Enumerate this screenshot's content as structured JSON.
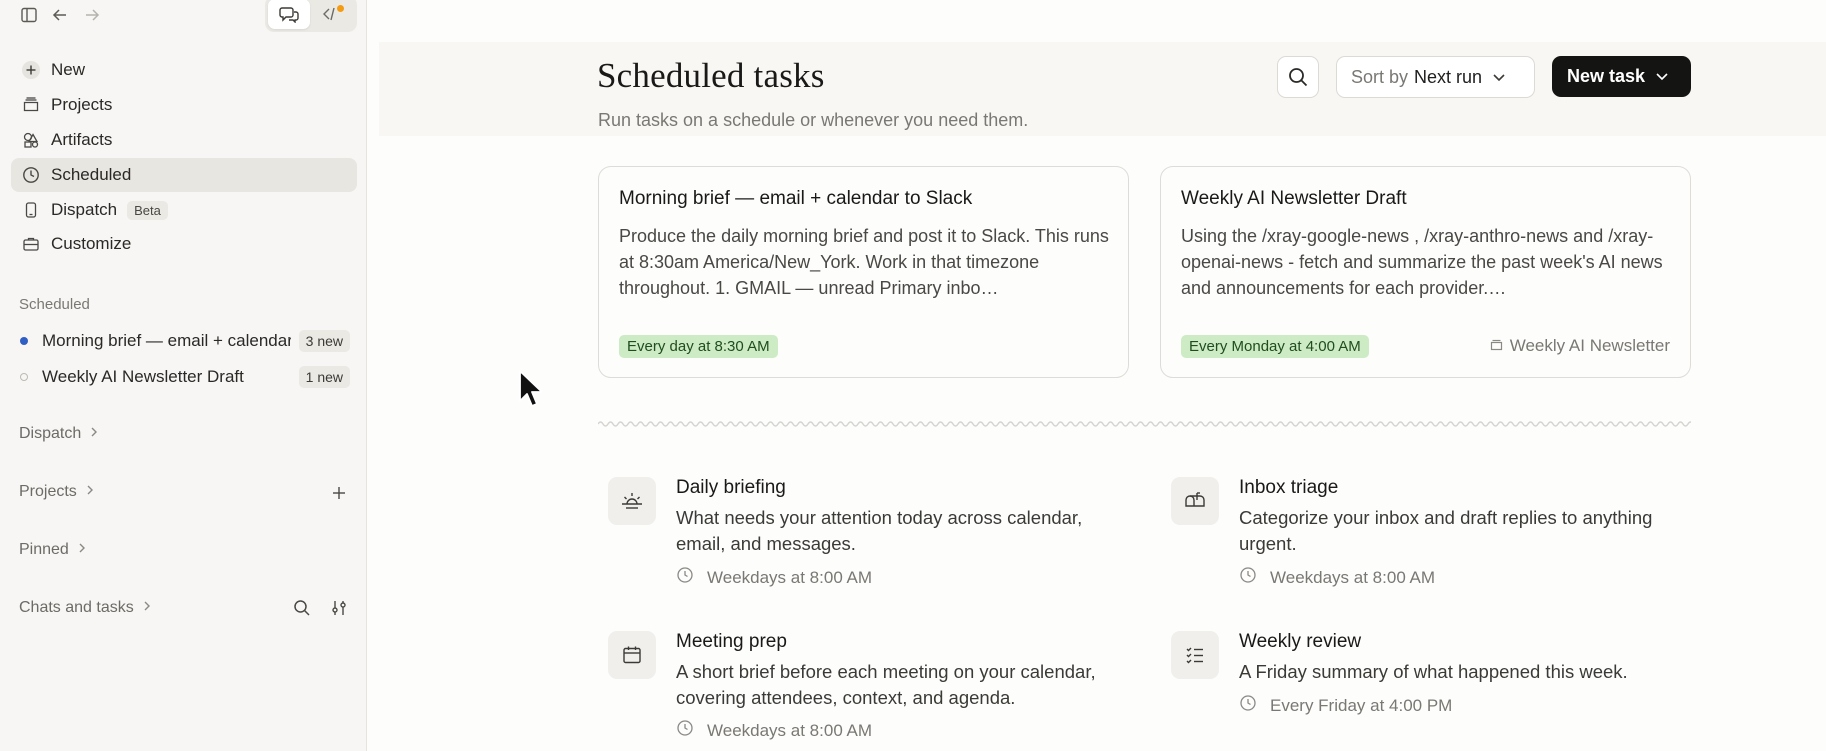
{
  "sidebar": {
    "nav": [
      {
        "label": "New",
        "icon": "plus-icon"
      },
      {
        "label": "Projects",
        "icon": "folder-icon"
      },
      {
        "label": "Artifacts",
        "icon": "shapes-icon"
      },
      {
        "label": "Scheduled",
        "icon": "clock-icon"
      },
      {
        "label": "Dispatch",
        "icon": "phone-icon",
        "badge": "Beta"
      },
      {
        "label": "Customize",
        "icon": "briefcase-icon"
      }
    ],
    "scheduled_label": "Scheduled",
    "scheduled_items": [
      {
        "name": "Morning brief — email + calendar to Slack",
        "badge": "3 new"
      },
      {
        "name": "Weekly AI Newsletter Draft",
        "badge": "1 new"
      }
    ],
    "dispatch_label": "Dispatch",
    "projects_label": "Projects",
    "pinned_label": "Pinned",
    "chats_label": "Chats and tasks"
  },
  "header": {
    "title": "Scheduled tasks",
    "subtitle": "Run tasks on a schedule or whenever you need them.",
    "sort_prefix": "Sort by",
    "sort_value": "Next run",
    "new_task_label": "New task"
  },
  "cards": [
    {
      "title": "Morning brief — email + calendar to Slack",
      "description": "Produce the daily morning brief and post it to Slack. This runs at 8:30am America/New_York. Work in that timezone throughout. 1. GMAIL — unread Primary inbo…",
      "schedule": "Every day at 8:30 AM",
      "project": ""
    },
    {
      "title": "Weekly AI Newsletter Draft",
      "description": "Using the /xray-google-news , /xray-anthro-news and /xray-openai-news - fetch and summarize the past week's AI news and announcements for each provider.…",
      "schedule": "Every Monday at 4:00 AM",
      "project": "Weekly AI Newsletter"
    }
  ],
  "templates": [
    {
      "name": "Daily briefing",
      "description": "What needs your attention today across calendar, email, and messages.",
      "schedule": "Weekdays at 8:00 AM",
      "icon": "sunrise-icon"
    },
    {
      "name": "Inbox triage",
      "description": "Categorize your inbox and draft replies to anything urgent.",
      "schedule": "Weekdays at 8:00 AM",
      "icon": "mailbox-icon"
    },
    {
      "name": "Meeting prep",
      "description": "A short brief before each meeting on your calendar, covering attendees, context, and agenda.",
      "schedule": "Weekdays at 8:00 AM",
      "icon": "calendar-icon"
    },
    {
      "name": "Weekly review",
      "description": "A Friday summary of what happened this week.",
      "schedule": "Every Friday at 4:00 PM",
      "icon": "checklist-icon"
    }
  ],
  "colors": {
    "accent_dark": "#141413",
    "schedule_pill_bg": "#cdebc4",
    "active_dot": "#2f5ec4",
    "notification_dot": "#f39c12"
  }
}
